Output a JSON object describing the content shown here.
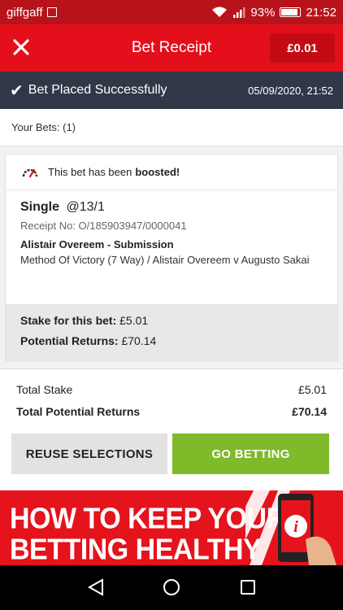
{
  "status_bar": {
    "carrier": "giffgaff",
    "battery": "93%",
    "battery_level": 0.93,
    "time": "21:52"
  },
  "header": {
    "title": "Bet Receipt",
    "balance": "£0.01",
    "close_icon": "close-icon"
  },
  "success_bar": {
    "message": "Bet Placed Successfully",
    "datetime": "05/09/2020, 21:52"
  },
  "your_bets": "Your Bets: (1)",
  "bet": {
    "boost_text": "This bet has been",
    "boost_bold": "boosted!",
    "type": "Single",
    "odds": "@13/1",
    "receipt": "Receipt No: O/185903947/0000041",
    "selection": "Alistair Overeem - Submission",
    "market": "Method Of Victory (7 Way) / Alistair Overeem v Augusto Sakai",
    "stake_label": "Stake for this bet:",
    "stake_value": "£5.01",
    "returns_label": "Potential Returns:",
    "returns_value": "£70.14"
  },
  "totals": {
    "stake_label": "Total Stake",
    "stake_value": "£5.01",
    "returns_label": "Total Potential Returns",
    "returns_value": "£70.14"
  },
  "buttons": {
    "reuse": "REUSE SELECTIONS",
    "go": "GO BETTING"
  },
  "banner": {
    "line1": "HOW TO KEEP YOUR",
    "line2": "BETTING HEALTHY"
  },
  "colors": {
    "header_red": "#e30f1b",
    "success_bar": "#303848",
    "go_green": "#7fba2a"
  }
}
